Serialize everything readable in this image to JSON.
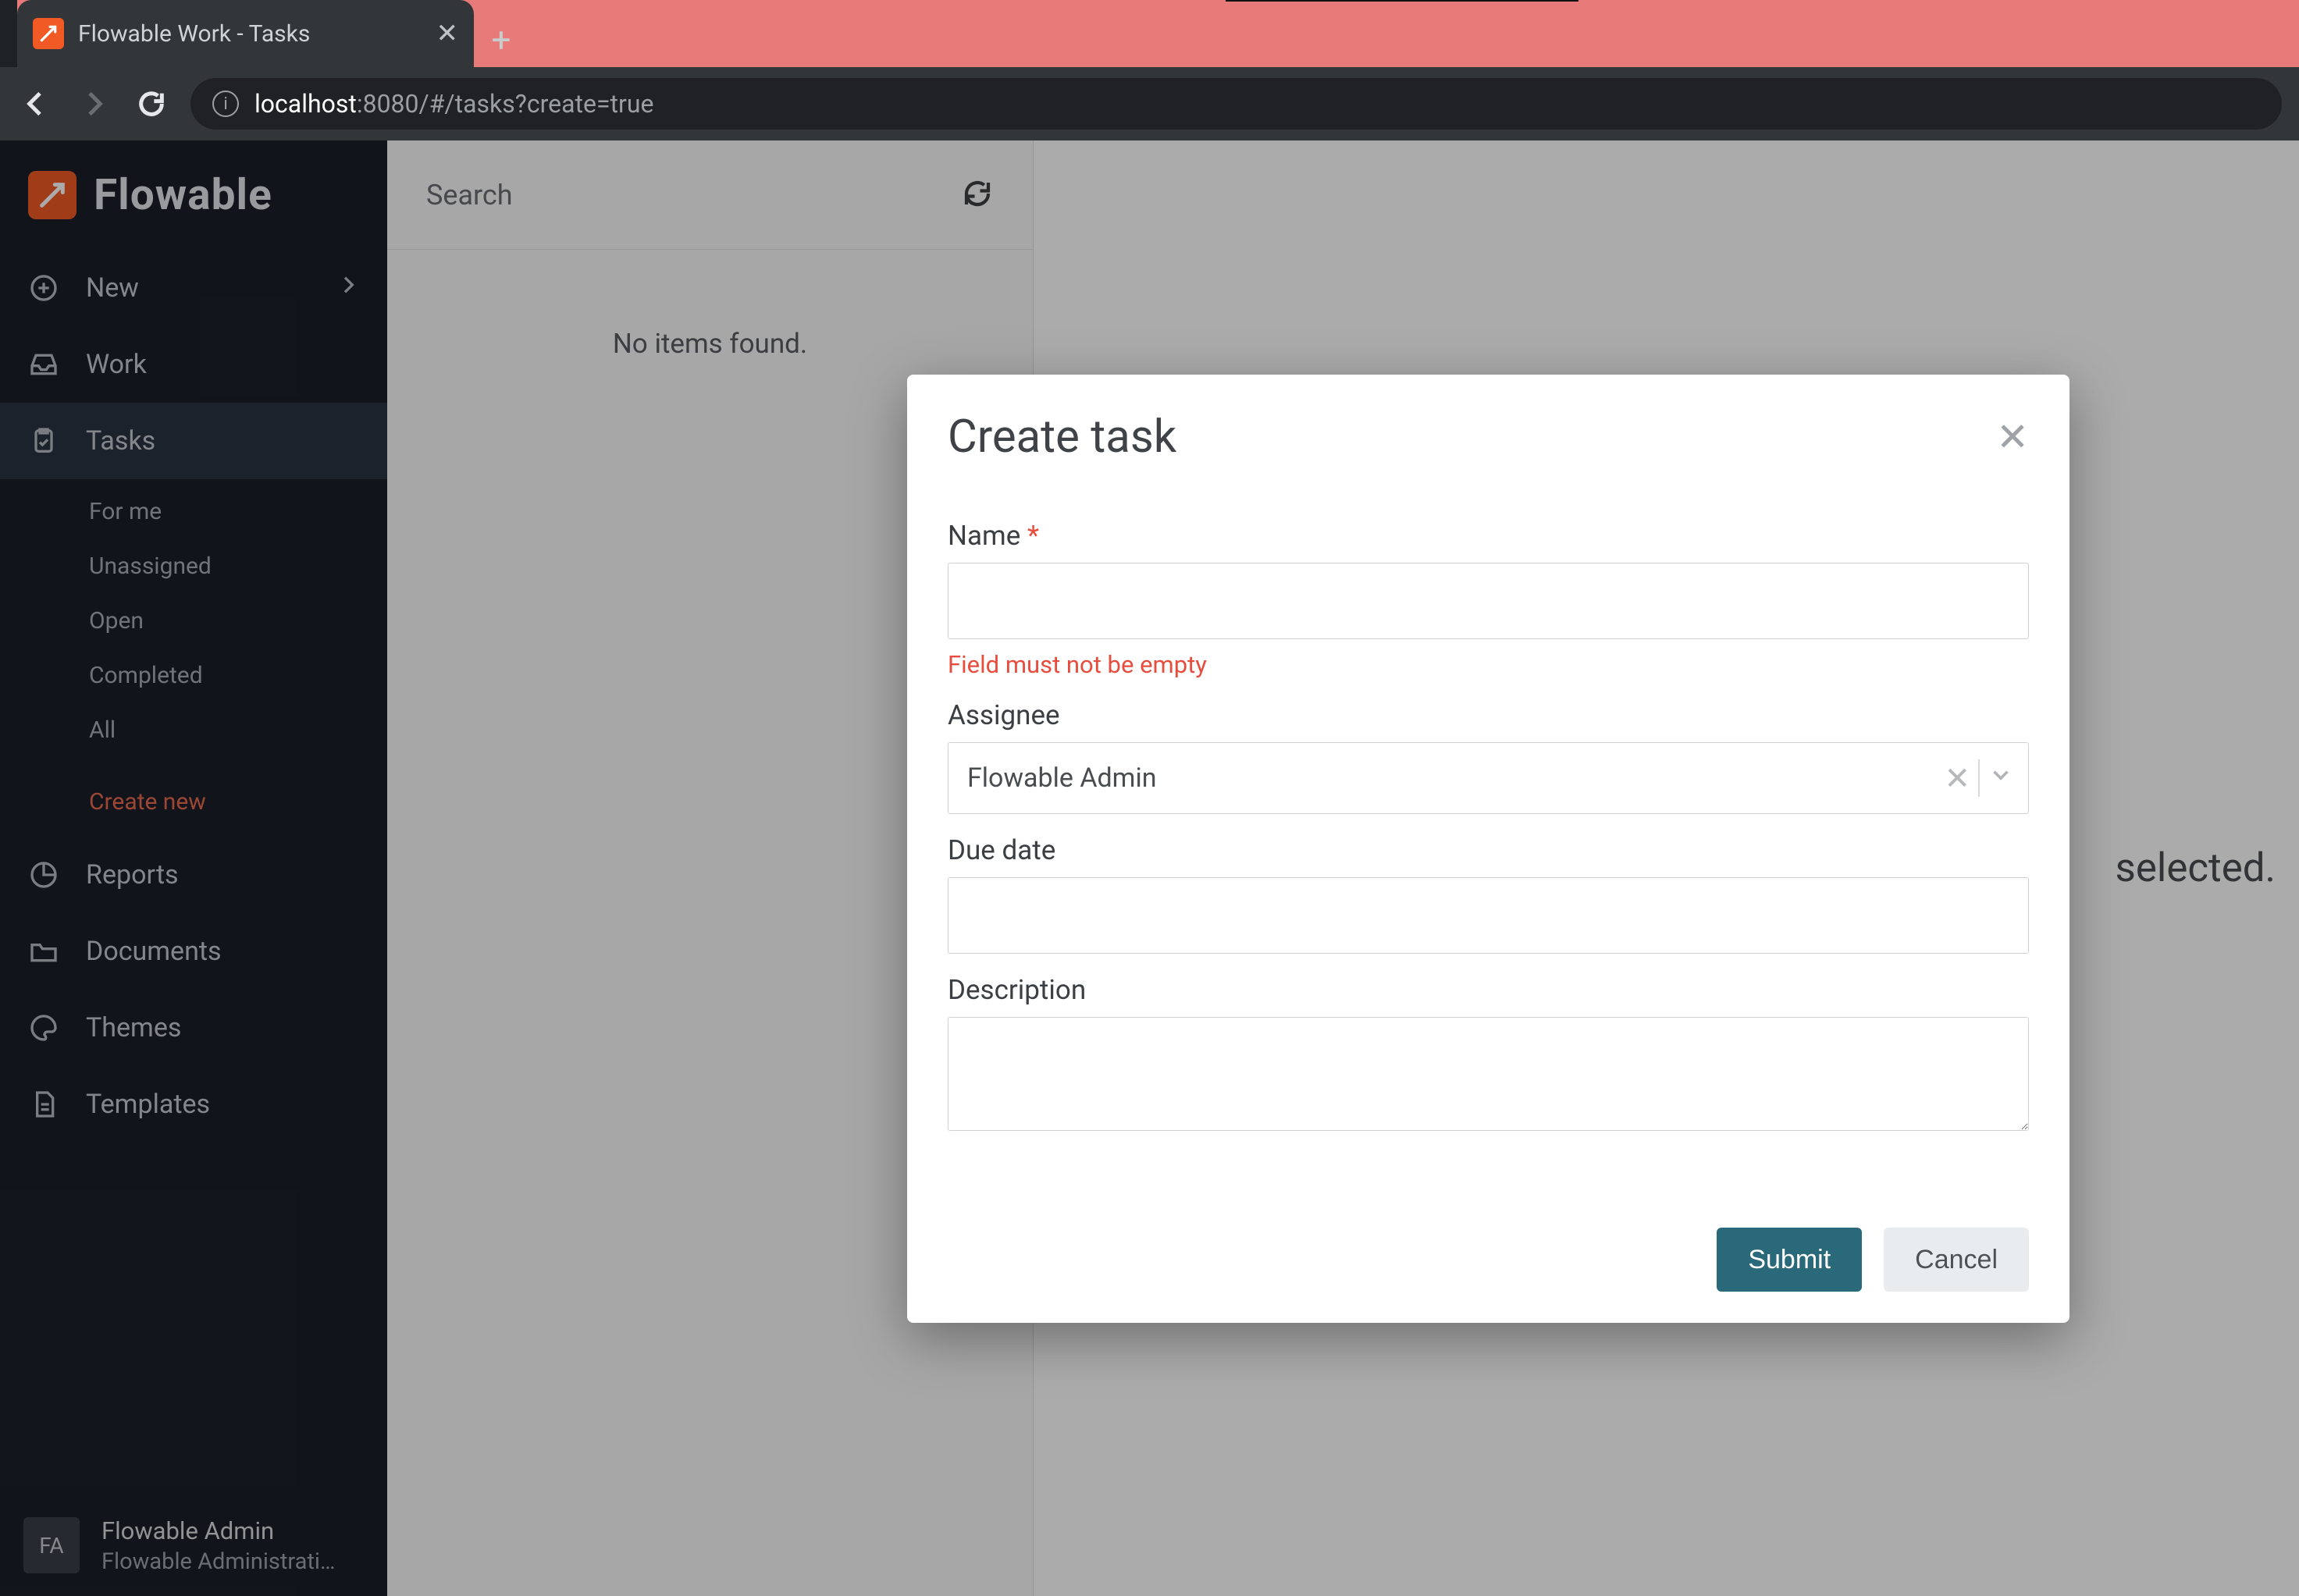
{
  "browser": {
    "tab_title": "Flowable Work - Tasks",
    "url_host": "localhost",
    "url_rest": ":8080/#/tasks?create=true"
  },
  "brand": {
    "name": "Flowable"
  },
  "sidebar": {
    "new": "New",
    "work": "Work",
    "tasks": "Tasks",
    "sub": {
      "for_me": "For me",
      "unassigned": "Unassigned",
      "open": "Open",
      "completed": "Completed",
      "all": "All",
      "create_new": "Create new"
    },
    "reports": "Reports",
    "documents": "Documents",
    "themes": "Themes",
    "templates": "Templates"
  },
  "user": {
    "initials": "FA",
    "name": "Flowable Admin",
    "role": "Flowable Administrati…"
  },
  "list": {
    "search_placeholder": "Search",
    "empty": "No items found."
  },
  "content": {
    "message": "selected."
  },
  "modal": {
    "title": "Create task",
    "name_label": "Name",
    "name_error": "Field must not be empty",
    "assignee_label": "Assignee",
    "assignee_value": "Flowable Admin",
    "due_label": "Due date",
    "desc_label": "Description",
    "submit": "Submit",
    "cancel": "Cancel"
  }
}
